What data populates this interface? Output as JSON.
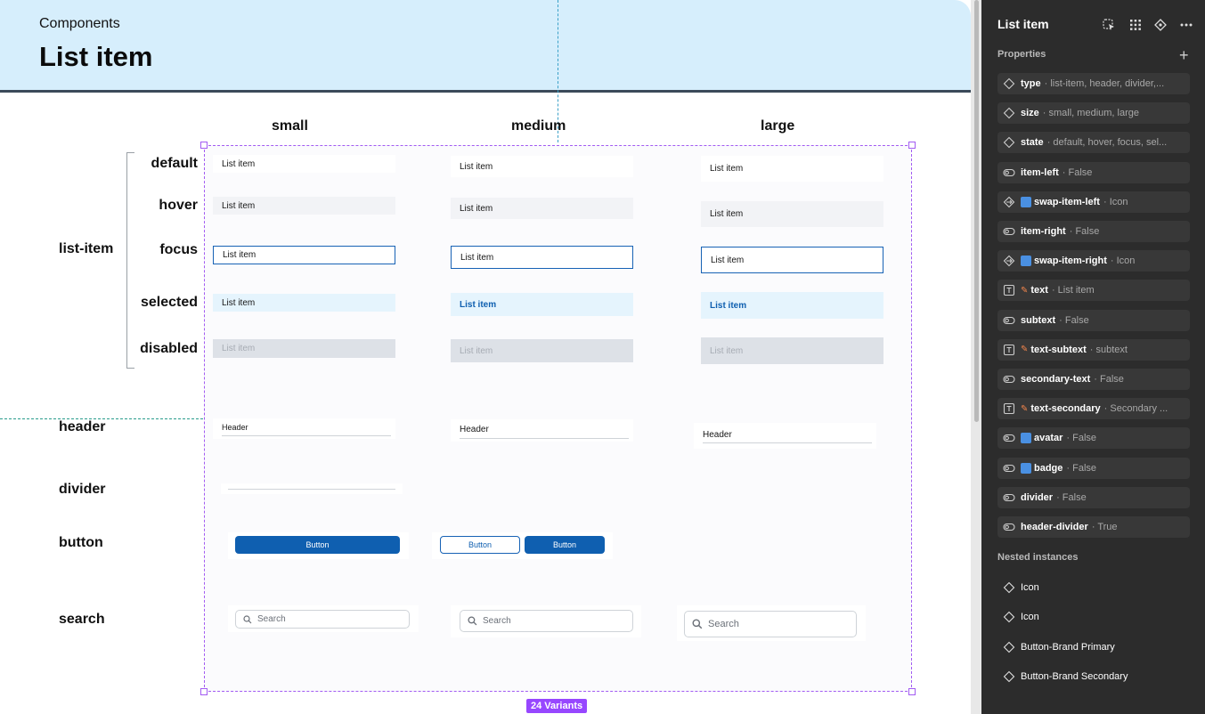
{
  "canvas": {
    "breadcrumb": "Components",
    "title": "List item",
    "columns": [
      "small",
      "medium",
      "large"
    ],
    "row_labels": {
      "list_item": "list-item",
      "header": "header",
      "divider": "divider",
      "button": "button",
      "search": "search"
    },
    "states": [
      "default",
      "hover",
      "focus",
      "selected",
      "disabled"
    ],
    "item_text": "List item",
    "header_text": "Header",
    "button_text": "Button",
    "search_placeholder": "Search",
    "variants_badge": "24 Variants"
  },
  "panel": {
    "title": "List item",
    "properties_label": "Properties",
    "properties": [
      {
        "icon": "variant-icon",
        "name": "type",
        "value": "list-item, header, divider,...",
        "extra": ""
      },
      {
        "icon": "variant-icon",
        "name": "size",
        "value": "small, medium, large",
        "extra": ""
      },
      {
        "icon": "variant-icon",
        "name": "state",
        "value": "default, hover, focus, sel...",
        "extra": ""
      },
      {
        "icon": "toggle-icon",
        "name": "item-left",
        "value": "False",
        "extra": ""
      },
      {
        "icon": "swap-icon",
        "name": "swap-item-left",
        "value": "Icon",
        "extra": "sub"
      },
      {
        "icon": "toggle-icon",
        "name": "item-right",
        "value": "False",
        "extra": ""
      },
      {
        "icon": "swap-icon",
        "name": "swap-item-right",
        "value": "Icon",
        "extra": "sub"
      },
      {
        "icon": "text-icon",
        "name": "text",
        "value": "List item",
        "extra": "pencil"
      },
      {
        "icon": "toggle-icon",
        "name": "subtext",
        "value": "False",
        "extra": ""
      },
      {
        "icon": "text-icon",
        "name": "text-subtext",
        "value": "subtext",
        "extra": "pencil"
      },
      {
        "icon": "toggle-icon",
        "name": "secondary-text",
        "value": "False",
        "extra": ""
      },
      {
        "icon": "text-icon",
        "name": "text-secondary",
        "value": "Secondary ...",
        "extra": "pencil"
      },
      {
        "icon": "toggle-icon",
        "name": "avatar",
        "value": "False",
        "extra": "sub"
      },
      {
        "icon": "toggle-icon",
        "name": "badge",
        "value": "False",
        "extra": "sub"
      },
      {
        "icon": "toggle-icon",
        "name": "divider",
        "value": "False",
        "extra": ""
      },
      {
        "icon": "toggle-icon",
        "name": "header-divider",
        "value": "True",
        "extra": ""
      }
    ],
    "nested_label": "Nested instances",
    "nested": [
      "Icon",
      "Icon",
      "Button-Brand Primary",
      "Button-Brand Secondary"
    ]
  }
}
